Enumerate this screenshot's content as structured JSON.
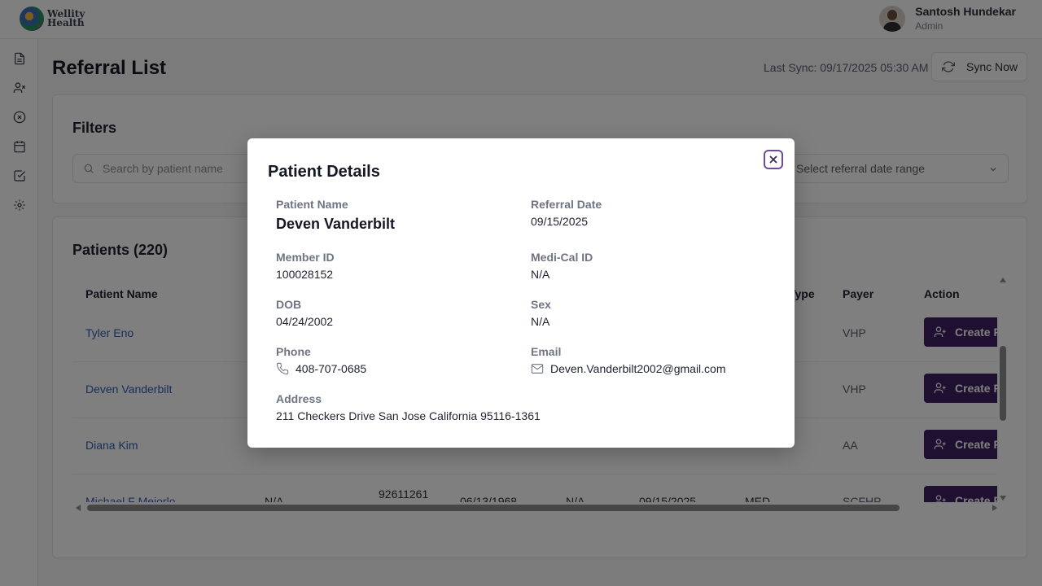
{
  "app": {
    "logo_line1": "Wellity",
    "logo_line2": "Health",
    "user_name": "Santosh Hundekar",
    "user_role": "Admin"
  },
  "sidebar": {
    "items": [
      {
        "icon": "document-icon"
      },
      {
        "icon": "user-x-icon"
      },
      {
        "icon": "x-circle-icon"
      },
      {
        "icon": "calendar-icon"
      },
      {
        "icon": "check-square-icon"
      },
      {
        "icon": "gear-icon"
      }
    ]
  },
  "header": {
    "title": "Referral List",
    "last_sync": "Last Sync: 09/17/2025 05:30 AM",
    "sync_button": "Sync Now"
  },
  "filters": {
    "title": "Filters",
    "search_placeholder": "Search by patient name",
    "date_range_placeholder": "Select referral date range"
  },
  "patients": {
    "title": "Patients (220)",
    "columns": {
      "name": "Patient Name",
      "type": "Type",
      "payer": "Payer",
      "action": "Action"
    },
    "rows": [
      {
        "name": "Tyler Eno",
        "col2": "",
        "col3": "",
        "col4": "",
        "col5": "",
        "col6": "",
        "type": "",
        "payer": "VHP",
        "action": "Create R"
      },
      {
        "name": "Deven Vanderbilt",
        "col2": "",
        "col3": "",
        "col4": "",
        "col5": "",
        "col6": "",
        "type": "",
        "payer": "VHP",
        "action": "Create R"
      },
      {
        "name": "Diana Kim",
        "col2": "",
        "col3": "",
        "col4": "",
        "col5": "",
        "col6": "",
        "type": "",
        "payer": "AA",
        "action": "Create R"
      },
      {
        "name": "Michael F Mejorlo",
        "col2": "N/A",
        "col3": "92611261",
        "col4": "06/13/1968",
        "col5": "N/A",
        "col6": "09/15/2025",
        "type": "MED",
        "payer": "SCFHP",
        "action": "Create R"
      }
    ]
  },
  "modal": {
    "title": "Patient Details",
    "fields": {
      "patient_name": {
        "label": "Patient Name",
        "value": "Deven Vanderbilt"
      },
      "referral_date": {
        "label": "Referral Date",
        "value": "09/15/2025"
      },
      "member_id": {
        "label": "Member ID",
        "value": "100028152"
      },
      "medi_cal_id": {
        "label": "Medi-Cal ID",
        "value": "N/A"
      },
      "dob": {
        "label": "DOB",
        "value": "04/24/2002"
      },
      "sex": {
        "label": "Sex",
        "value": "N/A"
      },
      "phone": {
        "label": "Phone",
        "value": "408-707-0685"
      },
      "email": {
        "label": "Email",
        "value": "Deven.Vanderbilt2002@gmail.com"
      },
      "address": {
        "label": "Address",
        "value": "211 Checkers Drive San Jose California 95116-1361"
      }
    }
  },
  "colors": {
    "primary": "#3e1f63",
    "link": "#2f5fb3",
    "overlay": "rgba(0,0,0,0.5)"
  }
}
